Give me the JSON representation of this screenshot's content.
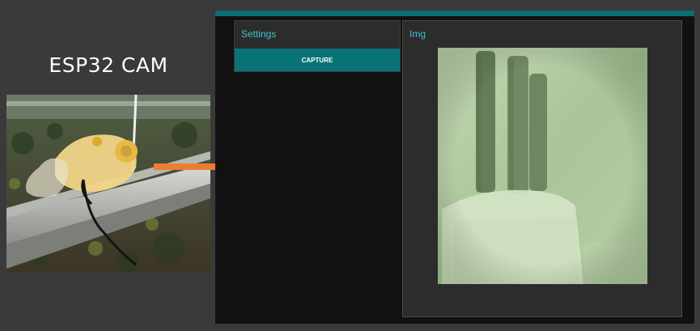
{
  "annotation": {
    "device_label": "ESP32 CAM"
  },
  "app": {
    "settings_panel": {
      "title": "Settings",
      "capture_label": "CAPTURE"
    },
    "image_panel": {
      "title": "Img"
    }
  },
  "colors": {
    "accent": "#0a6e73",
    "panel_title": "#3fc2cb",
    "arrow": "#ed7d31"
  },
  "icons": {
    "arrow": "right-arrow-icon"
  }
}
